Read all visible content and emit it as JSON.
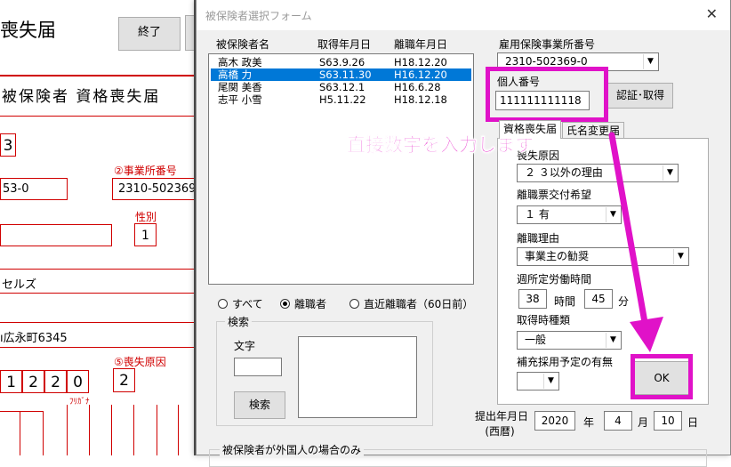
{
  "sheet": {
    "title": "喪失届",
    "end_button": "終了",
    "heading": "被保険者 資格喪失届",
    "cell_3": "3",
    "label_office_no": "②事業所番号",
    "office_no_left": "53-0",
    "office_no_right": "2310-502369",
    "label_gender": "性別",
    "gender_value": "1",
    "kana_name": "セルズ",
    "address": "ı広永町6345",
    "date_digits": [
      "1",
      "2",
      "2",
      "0"
    ],
    "label_reason": "⑤喪失原因",
    "reason_value": "2",
    "furigana": "ﾌﾘｶﾞﾅ"
  },
  "dialog": {
    "title": "被保険者選択フォーム",
    "close_icon": "✕",
    "list_headers": {
      "name": "被保険者名",
      "acquired": "取得年月日",
      "left": "離職年月日"
    },
    "insured_list": [
      {
        "name": "高木 政美",
        "acquired": "S63.9.26",
        "left": "H18.12.20",
        "selected": false
      },
      {
        "name": "高橋 力",
        "acquired": "S63.11.30",
        "left": "H16.12.20",
        "selected": true
      },
      {
        "name": "尾関 美香",
        "acquired": "S63.12.1",
        "left": "H16.6.28",
        "selected": false
      },
      {
        "name": "志平 小雪",
        "acquired": "H5.11.22",
        "left": "H18.12.18",
        "selected": false
      }
    ],
    "filter_radios": {
      "all": "すべて",
      "retired": "離職者",
      "recent": "直近離職者（60日前）",
      "selected": "retired"
    },
    "search_frame": {
      "caption": "検索",
      "text_label": "文字",
      "text_value": "",
      "search_button": "検索"
    },
    "foreign_frame_caption": "被保険者が外国人の場合のみ",
    "employment_office": {
      "label": "雇用保険事業所番号",
      "value": "2310-502369-0"
    },
    "personal_number": {
      "label": "個人番号",
      "value": "111111111118"
    },
    "verify_button": "認証･取得",
    "tabs": [
      "資格喪失届",
      "氏名変更届"
    ],
    "loss_tab": {
      "reason_label": "喪失原因",
      "reason_value": "２ ３以外の理由",
      "certificate_label": "離職票交付希望",
      "certificate_value": "１ 有",
      "separation_label": "離職理由",
      "separation_value": "事業主の勧奨",
      "weekly_hours_label": "週所定労働時間",
      "hours_value": "38",
      "hours_unit": "時間",
      "minutes_value": "45",
      "minutes_unit": "分",
      "acquisition_type_label": "取得時種類",
      "acquisition_type_value": "一般",
      "supplement_label": "補充採用予定の有無",
      "supplement_value": "",
      "ok_button": "OK"
    },
    "submit_date": {
      "label_line1": "提出年月日",
      "label_line2": "(西暦)",
      "year": "2020",
      "year_unit": "年",
      "month": "4",
      "month_unit": "月",
      "day": "10",
      "day_unit": "日"
    },
    "annotation_text": "直接数字を入力します"
  },
  "colors": {
    "highlight": "#e012c8",
    "selection": "#0078d7",
    "sheet_red": "#d00000"
  }
}
